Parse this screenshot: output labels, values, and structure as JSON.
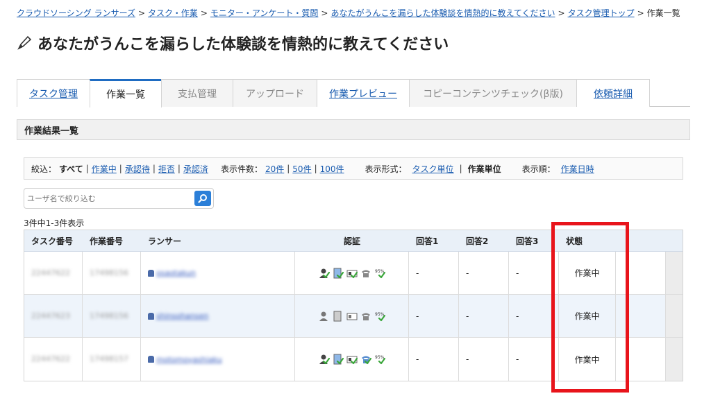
{
  "breadcrumb": {
    "items": [
      "クラウドソーシング ランサーズ",
      "タスク・作業",
      "モニター・アンケート・質問",
      "あなたがうんこを漏らした体験談を情熱的に教えてください",
      "タスク管理トップ"
    ],
    "current": "作業一覧",
    "separator": ">"
  },
  "page": {
    "title": "あなたがうんこを漏らした体験談を情熱的に教えてください"
  },
  "tabs": [
    {
      "label": "タスク管理",
      "state": "link"
    },
    {
      "label": "作業一覧",
      "state": "active"
    },
    {
      "label": "支払管理",
      "state": "disabled"
    },
    {
      "label": "アップロード",
      "state": "disabled"
    },
    {
      "label": "作業プレビュー",
      "state": "link"
    },
    {
      "label": "コピーコンテンツチェック(β版)",
      "state": "disabled"
    },
    {
      "label": "依頼詳細",
      "state": "link"
    }
  ],
  "section": {
    "title": "作業結果一覧"
  },
  "filter": {
    "narrow_label": "絞込：",
    "narrow_current": "すべて",
    "narrow_options": [
      "作業中",
      "承認待",
      "拒否",
      "承認済"
    ],
    "count_label": "表示件数：",
    "count_options": [
      "20件",
      "50件",
      "100件"
    ],
    "format_label": "表示形式：",
    "format_link": "タスク単位",
    "format_current": "作業単位",
    "order_label": "表示順：",
    "order_link": "作業日時"
  },
  "search": {
    "placeholder": "ユーザ名で絞り込む",
    "button_icon": "search-icon"
  },
  "result_count": "3件中1-3件表示",
  "table": {
    "headers": [
      "タスク番号",
      "作業番号",
      "ランサー",
      "認証",
      "回答1",
      "回答2",
      "回答3",
      "状態"
    ],
    "rows": [
      {
        "task_no": "22447622",
        "work_no": "17498156",
        "lancer": "osaotakun",
        "verified": [
          true,
          true,
          true,
          false,
          true
        ],
        "a1": "-",
        "a2": "-",
        "a3": "-",
        "status": "作業中"
      },
      {
        "task_no": "22447623",
        "work_no": "17498156",
        "lancer": "shinsohansen",
        "verified": [
          false,
          false,
          false,
          false,
          true
        ],
        "a1": "-",
        "a2": "-",
        "a3": "-",
        "status": "作業中"
      },
      {
        "task_no": "22447622",
        "work_no": "17498157",
        "lancer": "motomoyashiaku",
        "verified": [
          true,
          true,
          true,
          true,
          true
        ],
        "a1": "-",
        "a2": "-",
        "a3": "-",
        "status": "作業中"
      }
    ]
  },
  "colors": {
    "link": "#1a5cb0",
    "highlight": "#e8141b",
    "tab_active": "#1f6cc2",
    "search_button": "#2b7fd8"
  }
}
